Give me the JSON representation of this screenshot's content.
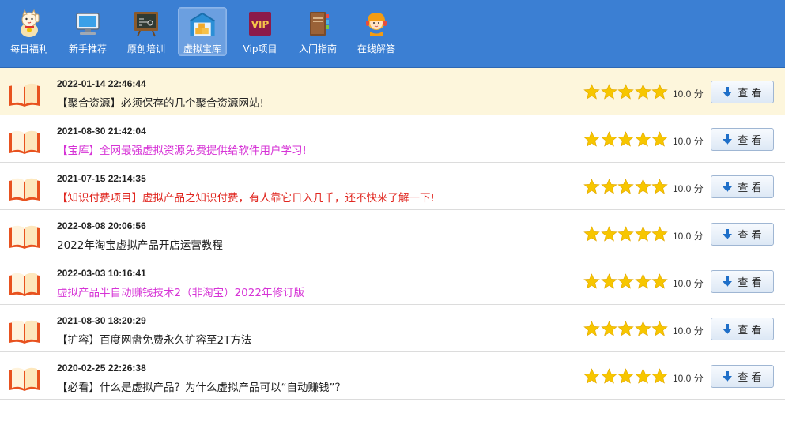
{
  "nav": {
    "items": [
      {
        "label": "每日福利",
        "icon": "lucky-cat-icon",
        "active": false
      },
      {
        "label": "新手推荐",
        "icon": "computer-icon",
        "active": false
      },
      {
        "label": "原创培训",
        "icon": "blackboard-icon",
        "active": false
      },
      {
        "label": "虚拟宝库",
        "icon": "warehouse-icon",
        "active": true
      },
      {
        "label": "Vip项目",
        "icon": "vip-icon",
        "active": false
      },
      {
        "label": "入门指南",
        "icon": "guide-book-icon",
        "active": false
      },
      {
        "label": "在线解答",
        "icon": "support-agent-icon",
        "active": false
      }
    ]
  },
  "colors": {
    "topbar": "#3b7fd3",
    "highlight_row": "#fdf6dc",
    "title_black": "#222222",
    "title_magenta": "#d633d6",
    "title_red": "#e0261f",
    "star": "#f7c600"
  },
  "list": {
    "score_unit": "分",
    "view_label": "查 看",
    "items": [
      {
        "date": "2022-01-14 22:46:44",
        "title": "【聚合资源】必须保存的几个聚合资源网站!",
        "color": "black",
        "rating": 5,
        "score": "10.0"
      },
      {
        "date": "2021-08-30 21:42:04",
        "title": "【宝库】全网最强虚拟资源免费提供给软件用户学习!",
        "color": "magenta",
        "rating": 5,
        "score": "10.0"
      },
      {
        "date": "2021-07-15 22:14:35",
        "title": "【知识付费项目】虚拟产品之知识付费，有人靠它日入几千，还不快来了解一下!",
        "color": "red",
        "rating": 5,
        "score": "10.0"
      },
      {
        "date": "2022-08-08 20:06:56",
        "title": "2022年淘宝虚拟产品开店运营教程",
        "color": "black",
        "rating": 5,
        "score": "10.0"
      },
      {
        "date": "2022-03-03 10:16:41",
        "title": "虚拟产品半自动赚钱技术2（非淘宝）2022年修订版",
        "color": "magenta",
        "rating": 5,
        "score": "10.0"
      },
      {
        "date": "2021-08-30 18:20:29",
        "title": "【扩容】百度网盘免费永久扩容至2T方法",
        "color": "black",
        "rating": 5,
        "score": "10.0"
      },
      {
        "date": "2020-02-25 22:26:38",
        "title": "【必看】什么是虚拟产品？为什么虚拟产品可以“自动赚钱”？",
        "color": "black",
        "rating": 5,
        "score": "10.0"
      }
    ]
  }
}
